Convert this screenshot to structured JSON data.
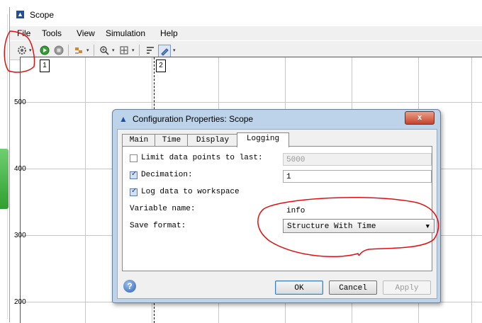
{
  "window": {
    "title": "Scope"
  },
  "menus": [
    "File",
    "Tools",
    "View",
    "Simulation",
    "Help"
  ],
  "toolbar": {
    "icons": [
      "gear-icon",
      "run-icon",
      "stop-icon",
      "step-icon",
      "zoom-in-icon",
      "autoscale-icon",
      "cursor-measure-icon",
      "edit-icon"
    ]
  },
  "plot": {
    "y_ticks": [
      "500",
      "400",
      "300",
      "200"
    ],
    "cursors": [
      "1",
      "2"
    ]
  },
  "dialog": {
    "title": "Configuration Properties: Scope",
    "close_label": "x",
    "tabs": [
      "Main",
      "Time",
      "Display",
      "Logging"
    ],
    "active_tab": "Logging",
    "limit_label": "Limit data points to last:",
    "limit_value": "5000",
    "limit_checked": false,
    "decimation_label": "Decimation:",
    "decimation_value": "1",
    "decimation_checked": true,
    "log_label": "Log data to workspace",
    "log_checked": true,
    "varname_label": "Variable name:",
    "varname_value": "info",
    "saveformat_label": "Save format:",
    "saveformat_value": "Structure With Time",
    "help_label": "?",
    "ok_label": "OK",
    "cancel_label": "Cancel",
    "apply_label": "Apply"
  },
  "colors": {
    "annotation": "#e01010",
    "dialog_frame": "#bcd3ea"
  }
}
